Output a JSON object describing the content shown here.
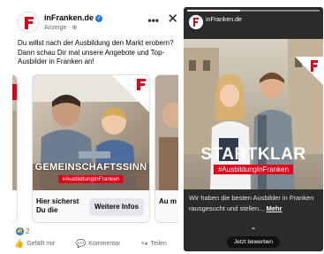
{
  "facebook_ad": {
    "page_name": "inFranken.de",
    "verified_mark": "✓",
    "sponsored_label": "Anzeige · ⊕",
    "more_icon": "more-horizontal-icon",
    "more_label": "•••",
    "close_label": "✕",
    "body_text": "Du willst nach der Ausbildung den Markt erobern? Dann schau Dir mal unsere Angebote und Top-Ausbilder in Franken an!",
    "brand_color": "#e2001a",
    "carousel": {
      "main_card": {
        "slogan": "GEMEINSCHAFTSSINN",
        "hashtag": "#AusbildungInFranken",
        "headline": "Hier sicherst Du die",
        "cta_label": "Weitere Infos"
      },
      "next_card": {
        "headline_fragment": "Au m"
      }
    },
    "reactions": {
      "like_icon": "thumbs-up-icon",
      "like_glyph": "👍",
      "count": "2"
    },
    "actions": [
      {
        "icon": "thumbs-up-icon",
        "glyph": "👍",
        "label": "Gefällt mir"
      },
      {
        "icon": "comment-icon",
        "glyph": "💬",
        "label": "Kommentar"
      },
      {
        "icon": "share-icon",
        "glyph": "↪",
        "label": "Teilen"
      }
    ]
  },
  "instagram_story": {
    "account_name": "inFranken.de",
    "progress": 0.4,
    "title": "STARTKLAR",
    "hashtag": "#AusbildungInFranken",
    "caption": "Wir haben die besten Ausbilder in Franken rausgesucht und stellen...",
    "more_label": "Mehr",
    "chevron": "⌃",
    "cta_label": "Jetzt bewerben"
  }
}
